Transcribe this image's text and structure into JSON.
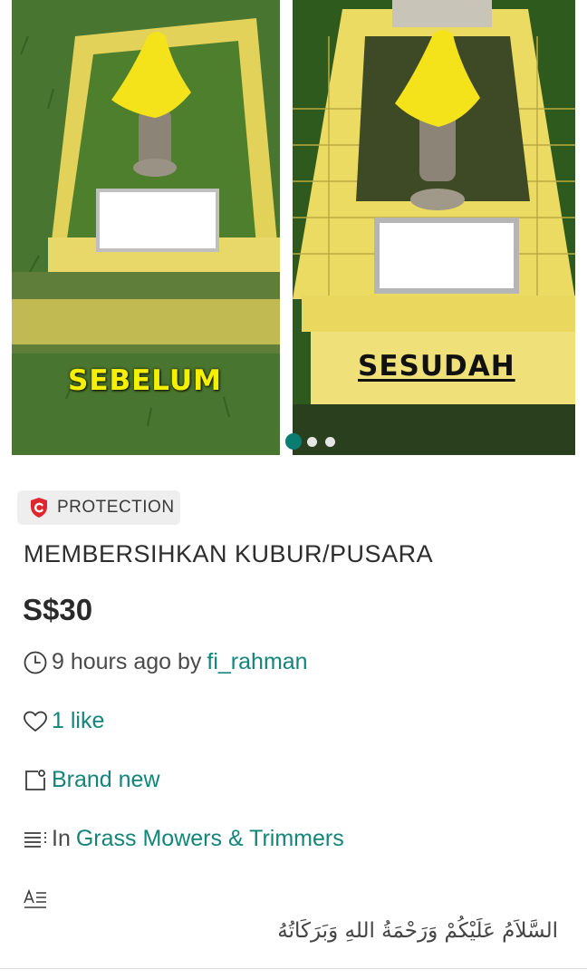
{
  "gallery": {
    "photos": [
      {
        "caption": "SEBELUM"
      },
      {
        "caption": "SESUDAH"
      }
    ],
    "active_index": 1,
    "total": 3,
    "accent_color": "#0a7d72"
  },
  "badge": {
    "label": "PROTECTION",
    "icon": "shield-check-icon",
    "icon_color": "#e0262f"
  },
  "listing": {
    "title": "MEMBERSIHKAN KUBUR/PUSARA",
    "price": "S$30",
    "posted": "9 hours ago by",
    "seller": "fi_rahman",
    "likes": "1 like",
    "condition": "Brand new",
    "category_prefix": "In",
    "category": "Grass Mowers & Trimmers",
    "description": "السَّلاَمُ عَلَيْكُمْ وَرَحْمَةُ اللهِ وَبَرَكَاتُهُ"
  },
  "colors": {
    "link": "#13857a",
    "text": "#2b2b2b"
  }
}
